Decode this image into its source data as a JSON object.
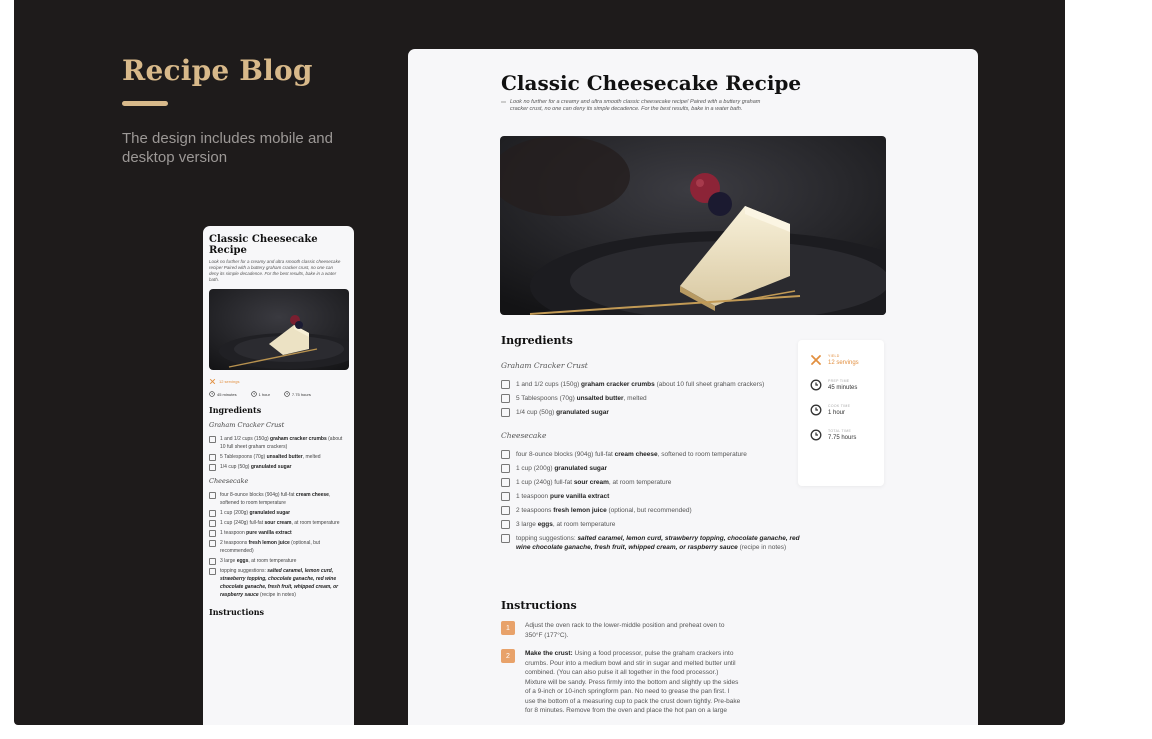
{
  "brand": {
    "title": "Recipe Blog",
    "subtitle": "The design includes mobile and desktop version"
  },
  "recipe": {
    "title": "Classic Cheesecake Recipe",
    "intro": "Look no further for a creamy and ultra smooth classic cheesecake recipe! Paired with a buttery graham cracker crust, no one can deny its simple decadence. For the best results, bake in a water bath.",
    "stats": {
      "yield_label": "YIELD",
      "yield_value": "12 servings",
      "prep_label": "PREP TIME",
      "prep_value": "45 minutes",
      "cook_label": "COOK TIME",
      "cook_value": "1 hour",
      "total_label": "TOTAL TIME",
      "total_value": "7.75 hours"
    },
    "ingredients_heading": "Ingredients",
    "crust_heading": "Graham Cracker Crust",
    "crust_items": [
      {
        "pre": "1 and 1/2 cups (150g) ",
        "bold": "graham cracker crumbs",
        "post": " (about 10 full sheet graham crackers)"
      },
      {
        "pre": "5 Tablespoons (70g) ",
        "bold": "unsalted butter",
        "post": ", melted"
      },
      {
        "pre": "1/4 cup (50g) ",
        "bold": "granulated sugar",
        "post": ""
      }
    ],
    "cheesecake_heading": "Cheesecake",
    "cheesecake_items": [
      {
        "pre": "four 8-ounce blocks (904g) full-fat ",
        "bold": "cream cheese",
        "post": ", softened to room temperature"
      },
      {
        "pre": "1 cup (200g) ",
        "bold": "granulated sugar",
        "post": ""
      },
      {
        "pre": "1 cup (240g) full-fat ",
        "bold": "sour cream",
        "post": ", at room temperature"
      },
      {
        "pre": "1 teaspoon ",
        "bold": "pure vanilla extract",
        "post": ""
      },
      {
        "pre": "2 teaspoons ",
        "bold": "fresh lemon juice",
        "post": " (optional, but recommended)"
      },
      {
        "pre": "3 large ",
        "bold": "eggs",
        "post": ", at room temperature"
      },
      {
        "pre": "topping suggestions: ",
        "bold": "salted caramel, lemon curd, strawberry topping, chocolate ganache, red wine chocolate ganache, fresh fruit, whipped cream, or raspberry sauce",
        "post": " (recipe in notes)"
      }
    ],
    "instructions_heading": "Instructions",
    "steps": [
      {
        "num": "1",
        "bold": "",
        "text": "Adjust the oven rack to the lower-middle position and preheat oven to 350°F (177°C)."
      },
      {
        "num": "2",
        "bold": "Make the crust: ",
        "text": "Using a food processor, pulse the graham crackers into crumbs. Pour into a medium bowl and stir in sugar and melted butter until combined. (You can also pulse it all together in the food processor.) Mixture will be sandy. Press firmly into the bottom and slightly up the sides of a 9-inch or 10-inch springform pan. No need to grease the pan first. I use the bottom of a measuring cup to pack the crust down tightly. Pre-bake for 8 minutes. Remove from the oven and place the hot pan on a large"
      }
    ]
  },
  "colors": {
    "background": "#1e1b1b",
    "accent_gold": "#d8b98a",
    "accent_orange": "#e28f3f",
    "step_badge": "#e8a26a",
    "card": "#f7f7f9"
  },
  "icons": [
    "utensils-icon",
    "clock-icon",
    "checkbox-icon",
    "cheesecake-photo"
  ]
}
